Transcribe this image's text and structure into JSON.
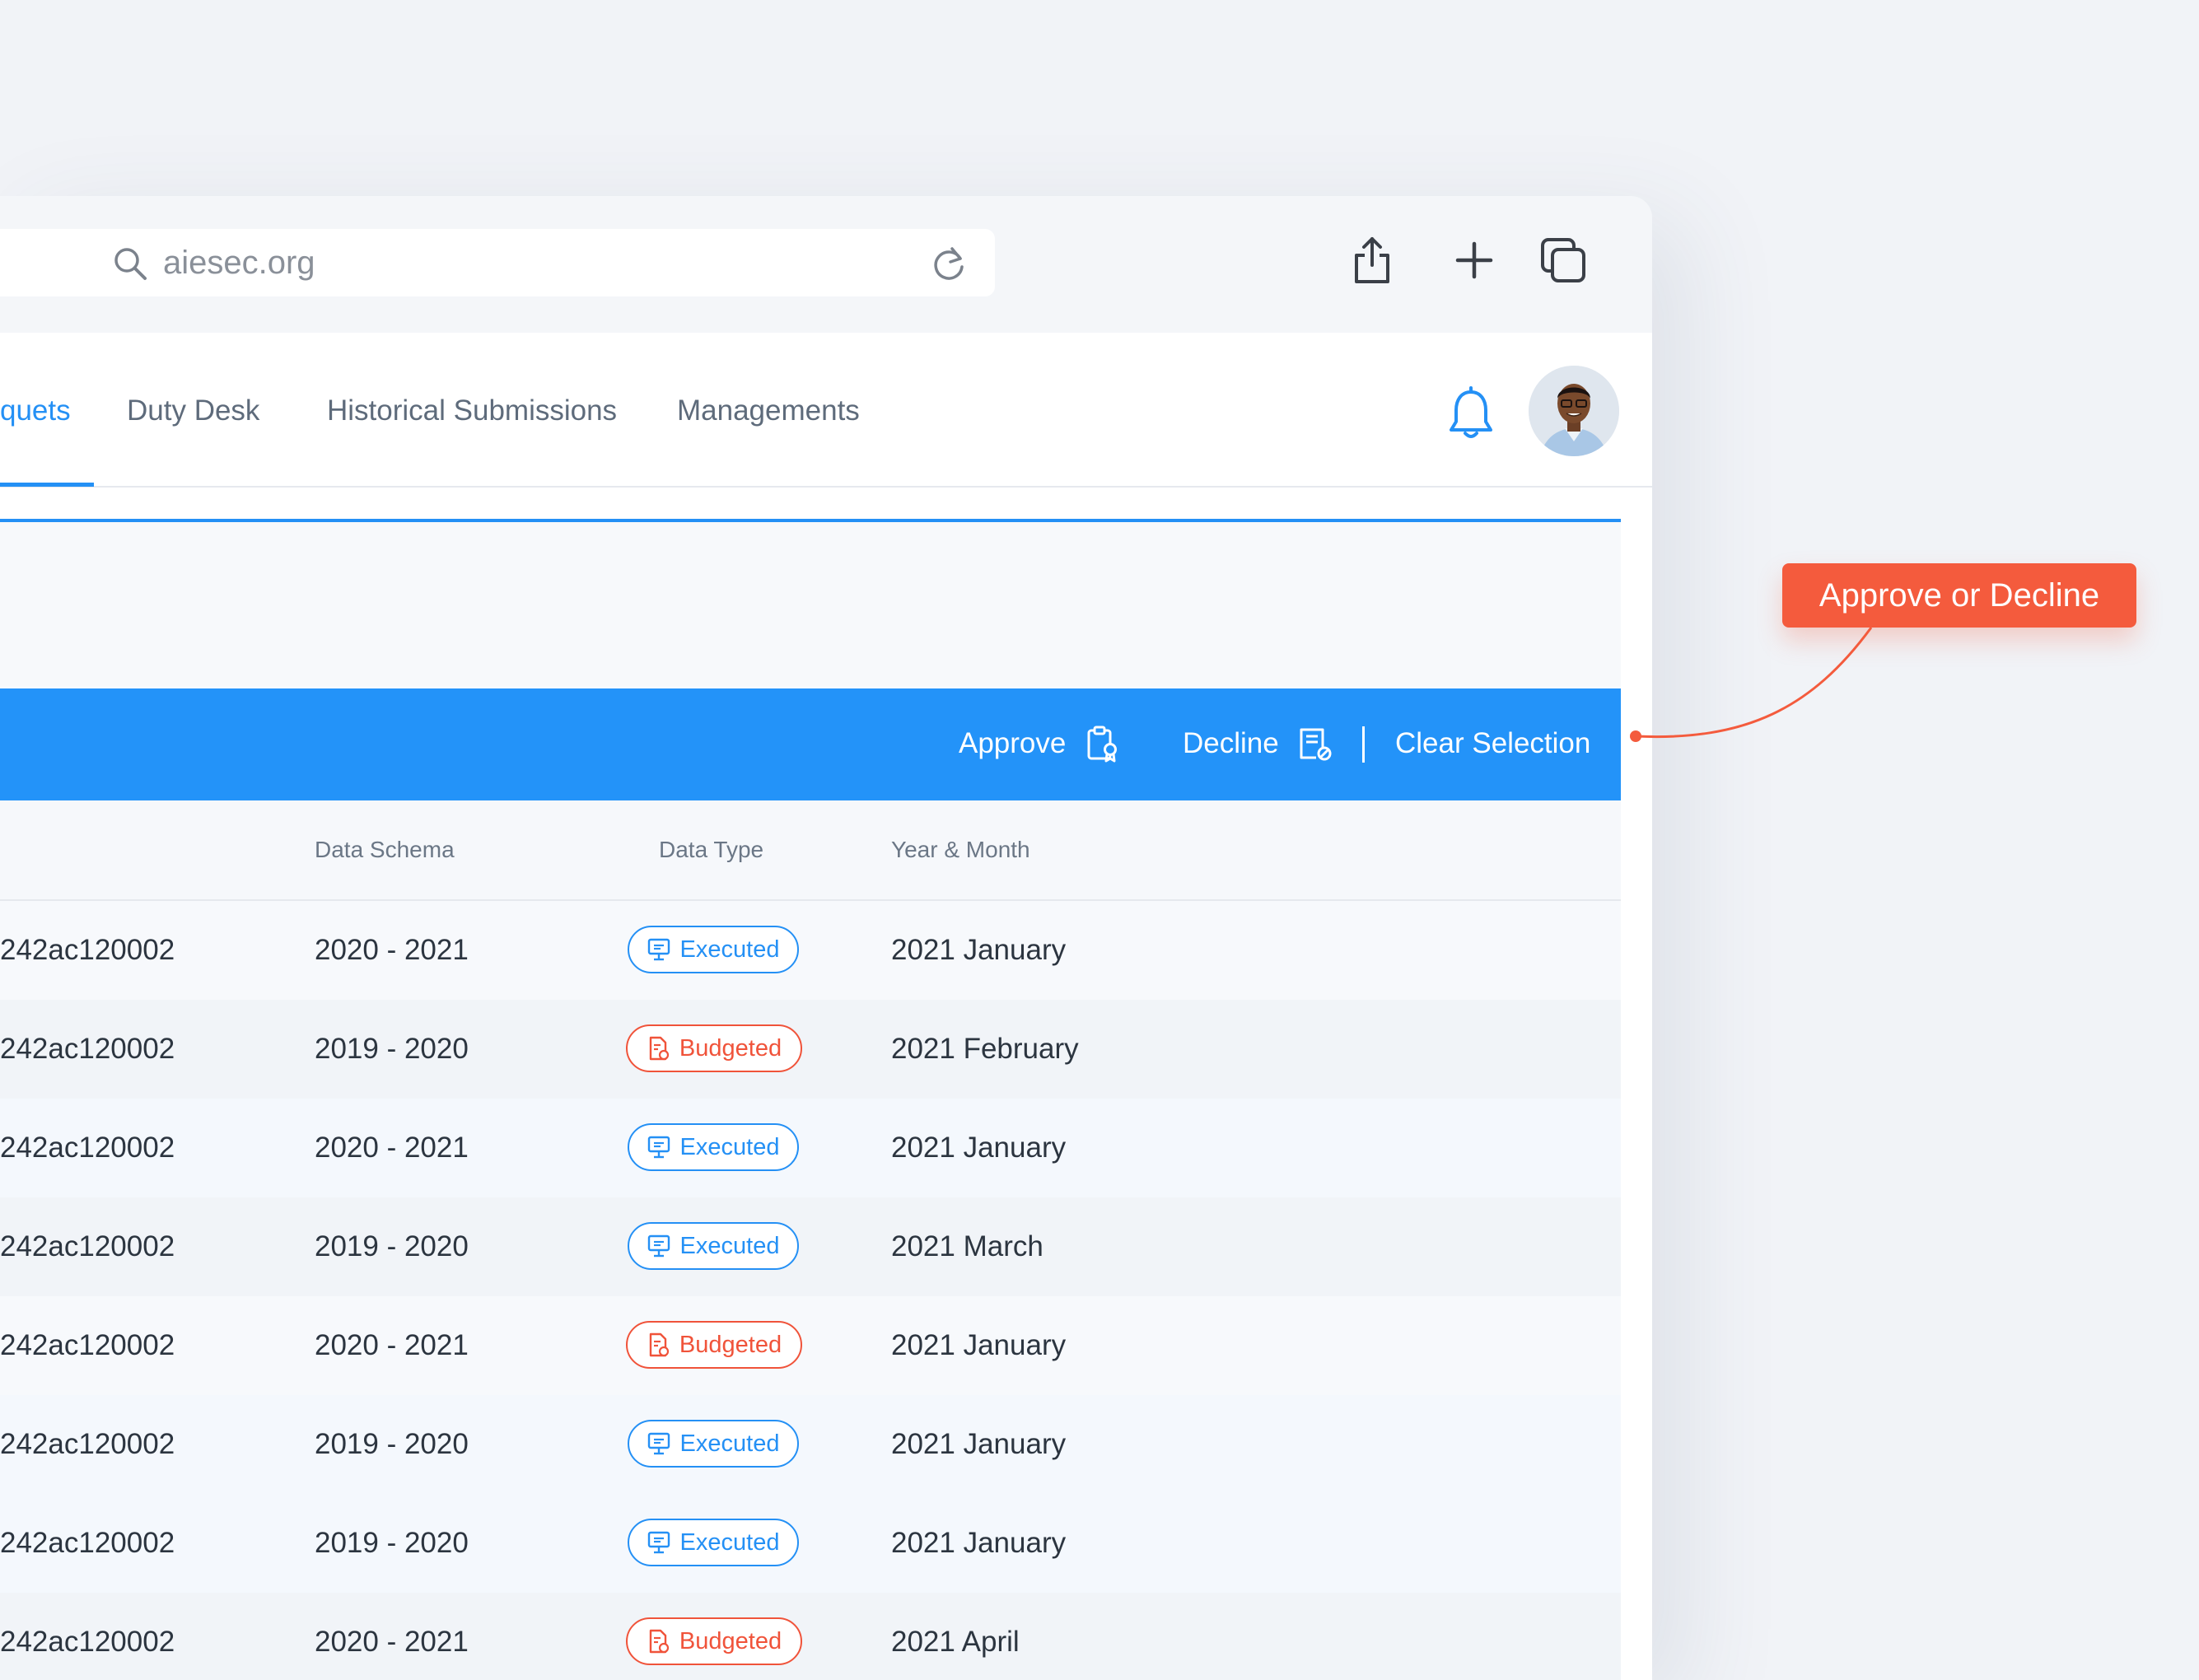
{
  "browser": {
    "url": "aiesec.org",
    "icons": [
      "search-icon",
      "reload-icon",
      "share-icon",
      "plus-icon",
      "tabs-icon"
    ]
  },
  "nav": {
    "tabs": [
      {
        "label": "quets",
        "active": true
      },
      {
        "label": "Duty Desk",
        "active": false
      },
      {
        "label": "Historical Submissions",
        "active": false
      },
      {
        "label": "Managements",
        "active": false
      }
    ],
    "icons": [
      "bell-icon",
      "avatar"
    ]
  },
  "action_bar": {
    "approve_label": "Approve",
    "decline_label": "Decline",
    "clear_label": "Clear Selection",
    "color": "#2393f9"
  },
  "table": {
    "headers": [
      "Data Schema",
      "Data Type",
      "Year & Month"
    ],
    "rows": [
      {
        "id": "242ac120002",
        "schema": "2020 - 2021",
        "type": "Executed",
        "month": "2021 January"
      },
      {
        "id": "242ac120002",
        "schema": "2019 - 2020",
        "type": "Budgeted",
        "month": "2021 February"
      },
      {
        "id": "242ac120002",
        "schema": "2020 - 2021",
        "type": "Executed",
        "month": "2021 January"
      },
      {
        "id": "242ac120002",
        "schema": "2019 - 2020",
        "type": "Executed",
        "month": "2021 March"
      },
      {
        "id": "242ac120002",
        "schema": "2020 - 2021",
        "type": "Budgeted",
        "month": "2021 January"
      },
      {
        "id": "242ac120002",
        "schema": "2019 - 2020",
        "type": "Executed",
        "month": "2021 January"
      },
      {
        "id": "242ac120002",
        "schema": "2019 - 2020",
        "type": "Executed",
        "month": "2021 January"
      },
      {
        "id": "242ac120002",
        "schema": "2020 - 2021",
        "type": "Budgeted",
        "month": "2021 April"
      }
    ],
    "status_colors": {
      "Executed": "#2490f5",
      "Budgeted": "#f0533a"
    }
  },
  "annotation": {
    "label": "Approve or Decline",
    "color": "#f45b3d"
  }
}
